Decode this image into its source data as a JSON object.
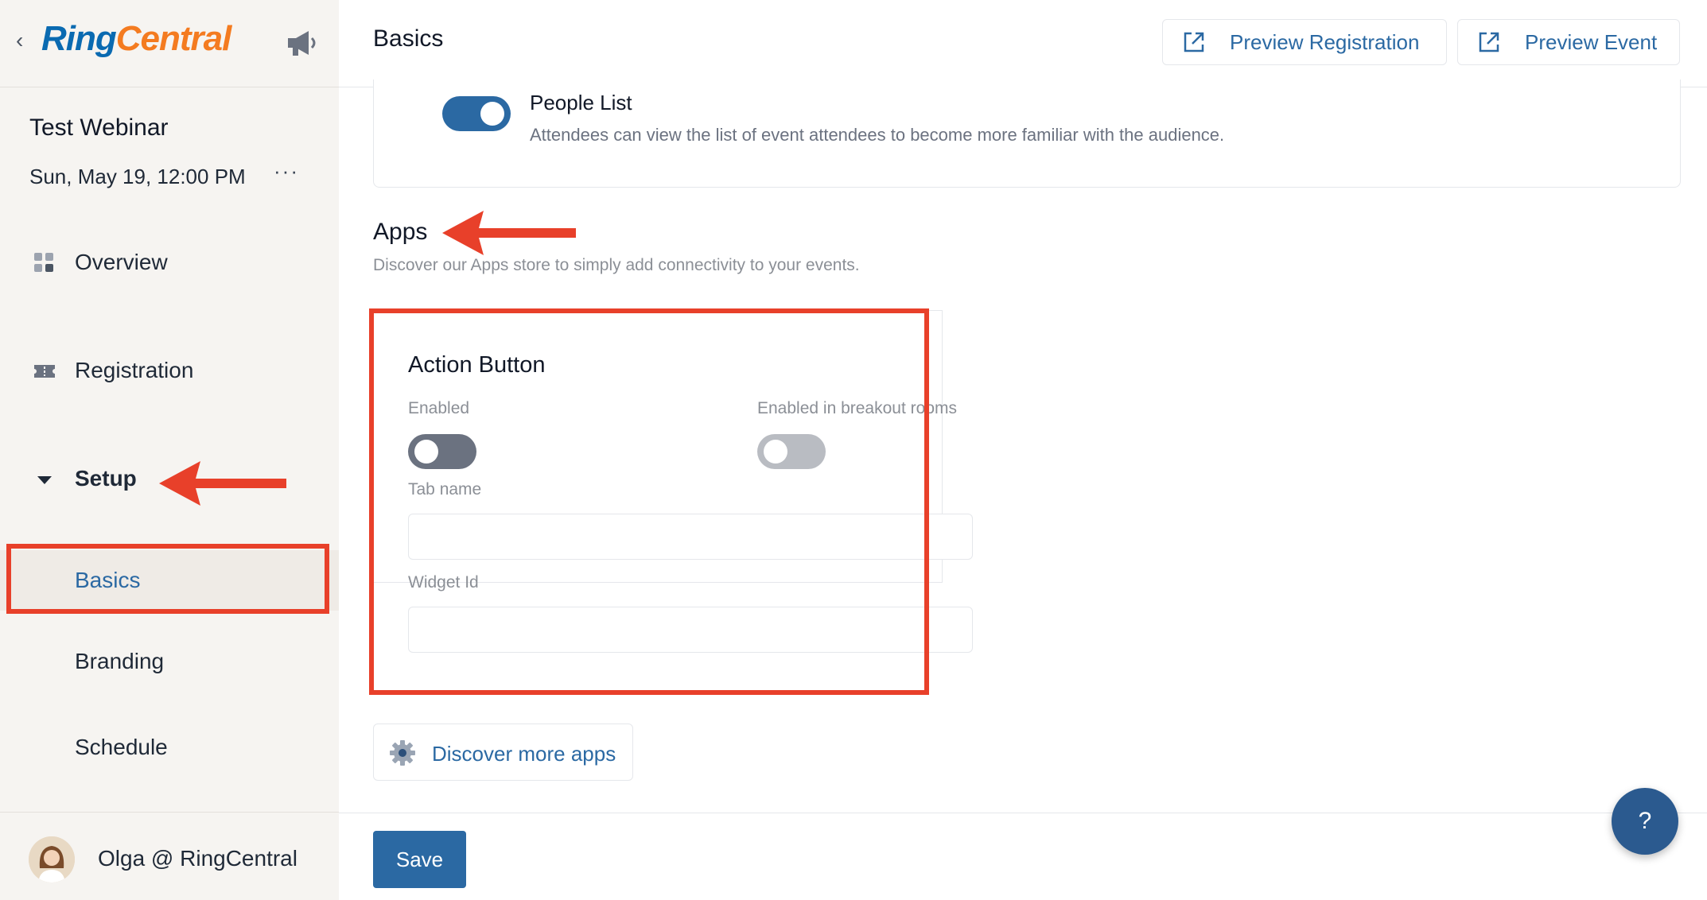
{
  "app": {
    "logo_ring": "Ring",
    "logo_central": "Central"
  },
  "event": {
    "title": "Test Webinar",
    "date": "Sun, May 19, 12:00 PM",
    "more": "···"
  },
  "sidebar": {
    "items": [
      {
        "label": "Overview"
      },
      {
        "label": "Registration"
      },
      {
        "label": "Setup"
      },
      {
        "label": "Basics"
      },
      {
        "label": "Branding"
      },
      {
        "label": "Schedule"
      }
    ],
    "user_name": "Olga @ RingCentral"
  },
  "topbar": {
    "page_title": "Basics",
    "preview_registration": "Preview Registration",
    "preview_event": "Preview Event"
  },
  "people_list": {
    "title": "People List",
    "description": "Attendees can view the list of event attendees to become more familiar with the audience.",
    "enabled": true
  },
  "apps": {
    "title": "Apps",
    "description": "Discover our Apps store to simply add connectivity to your events."
  },
  "action_button": {
    "title": "Action Button",
    "enabled_label": "Enabled",
    "breakout_label": "Enabled in breakout rooms",
    "tab_name_label": "Tab name",
    "tab_name_value": "",
    "widget_id_label": "Widget Id",
    "widget_id_value": "",
    "enabled": false,
    "breakout_enabled": false
  },
  "discover": {
    "label": "Discover more apps"
  },
  "bottombar": {
    "save_label": "Save",
    "help_label": "?"
  },
  "colors": {
    "accent": "#2b69a3",
    "annotation_red": "#e8402a",
    "logo_blue": "#0a6ab1",
    "logo_orange": "#f47b20"
  }
}
